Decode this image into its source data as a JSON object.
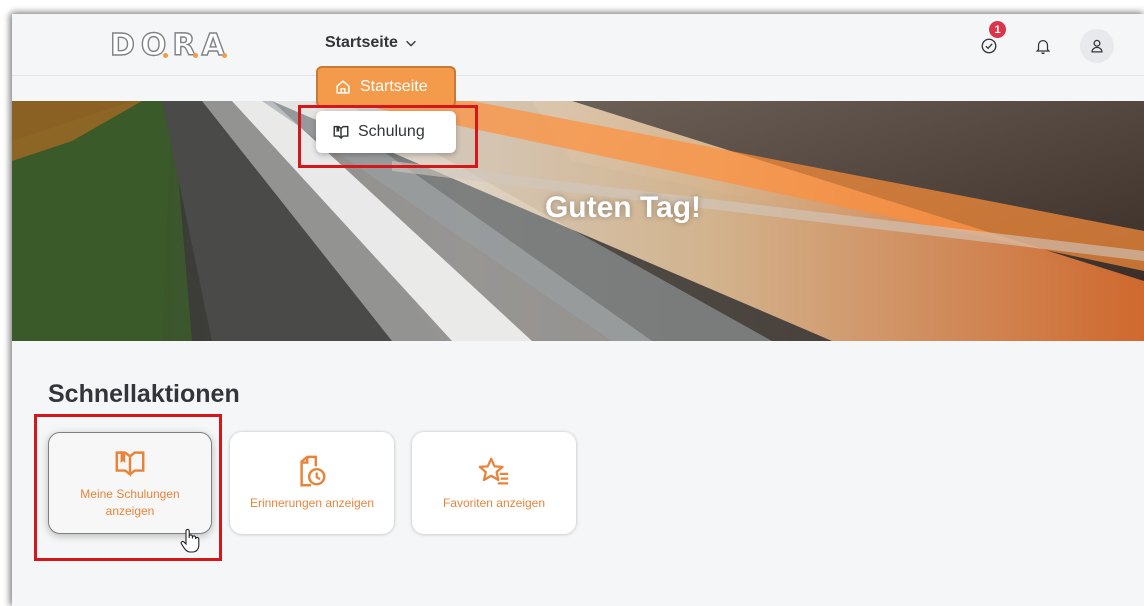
{
  "header": {
    "logo_letters": [
      "D",
      "O",
      "R",
      "A"
    ],
    "nav_label": "Startseite",
    "tasks_badge": "1",
    "icons": [
      "logo-icon",
      "chevron-down-icon",
      "task-check-icon",
      "bell-icon",
      "user-icon"
    ]
  },
  "dropdown": {
    "items": [
      {
        "label": "Startseite",
        "icon": "home-icon",
        "active": true
      },
      {
        "label": "Schulung",
        "icon": "book-icon",
        "active": false
      }
    ]
  },
  "hero": {
    "greeting": "Guten Tag!"
  },
  "quick_actions": {
    "title": "Schnellaktionen",
    "tiles": [
      {
        "label": "Meine Schulungen anzeigen",
        "icon": "book-icon"
      },
      {
        "label": "Erinnerungen anzeigen",
        "icon": "document-clock-icon"
      },
      {
        "label": "Favoriten anzeigen",
        "icon": "star-list-icon"
      }
    ]
  },
  "colors": {
    "accent": "#f39a4b",
    "accent_text": "#e8843a",
    "highlight_box": "#d3171b",
    "badge": "#d9364c"
  }
}
